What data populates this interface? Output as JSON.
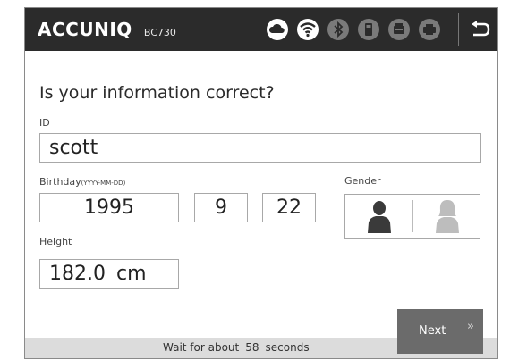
{
  "header": {
    "brand": "ACCUNIQ",
    "model": "BC730",
    "icons": [
      "cloud-icon",
      "wifi-icon",
      "bluetooth-icon",
      "printer-icon",
      "printer-icon",
      "printer-icon"
    ],
    "back_icon": "back-arrow-icon"
  },
  "form": {
    "question": "Is your information correct?",
    "id_label": "ID",
    "id_value": "scott",
    "birthday_label": "Birthday",
    "birthday_hint": "(YYYY-MM-DD)",
    "birth_year": "1995",
    "birth_month": "9",
    "birth_day": "22",
    "gender_label": "Gender",
    "gender_options": [
      "male",
      "female"
    ],
    "gender_selected": "male",
    "height_label": "Height",
    "height_value": "182.0",
    "height_unit": "cm"
  },
  "footer": {
    "wait_prefix": "Wait for about",
    "wait_seconds": "58",
    "wait_suffix": "seconds",
    "next_label": "Next",
    "next_arrow": "»"
  },
  "colors": {
    "topbar": "#2b2b2b",
    "next_button": "#6b6b6b",
    "bottombar": "#dcdcdc",
    "male_selected": "#3a3a3a",
    "female_unselected": "#bdbdbd"
  }
}
